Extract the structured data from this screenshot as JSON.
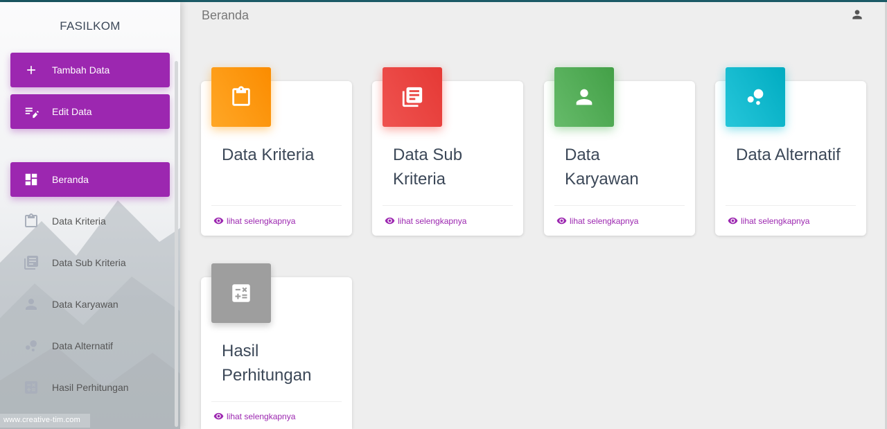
{
  "sidebar": {
    "brand": "FASILKOM",
    "actions": [
      {
        "label": "Tambah Data",
        "icon": "plus-icon"
      },
      {
        "label": "Edit Data",
        "icon": "edit-note-icon"
      }
    ],
    "items": [
      {
        "label": "Beranda",
        "icon": "dashboard-icon",
        "active": true
      },
      {
        "label": "Data Kriteria",
        "icon": "clipboard-icon"
      },
      {
        "label": "Data Sub Kriteria",
        "icon": "library-books-icon"
      },
      {
        "label": "Data Karyawan",
        "icon": "person-icon"
      },
      {
        "label": "Data Alternatif",
        "icon": "bubble-chart-icon"
      },
      {
        "label": "Hasil Perhitungan",
        "icon": "calculate-icon"
      }
    ],
    "watermark": "www.creative-tim.com"
  },
  "header": {
    "title": "Beranda",
    "user_icon": "person-icon"
  },
  "cards": [
    {
      "title": "Data Kriteria",
      "link": "lihat selengkapnya",
      "icon": "clipboard-icon",
      "color": "#fb8c00"
    },
    {
      "title": "Data Sub Kriteria",
      "link": "lihat selengkapnya",
      "icon": "library-books-icon",
      "color": "#e53935"
    },
    {
      "title": "Data Karyawan",
      "link": "lihat selengkapnya",
      "icon": "person-icon",
      "color": "#43a047"
    },
    {
      "title": "Data Alternatif",
      "link": "lihat selengkapnya",
      "icon": "bubble-chart-icon",
      "color": "#00acc1"
    },
    {
      "title": "Hasil Perhitungan",
      "link": "lihat selengkapnya",
      "icon": "calculate-icon",
      "color": "#9e9e9e"
    }
  ],
  "colors": {
    "accent": "#9c27b0",
    "background": "#eeeeee"
  }
}
